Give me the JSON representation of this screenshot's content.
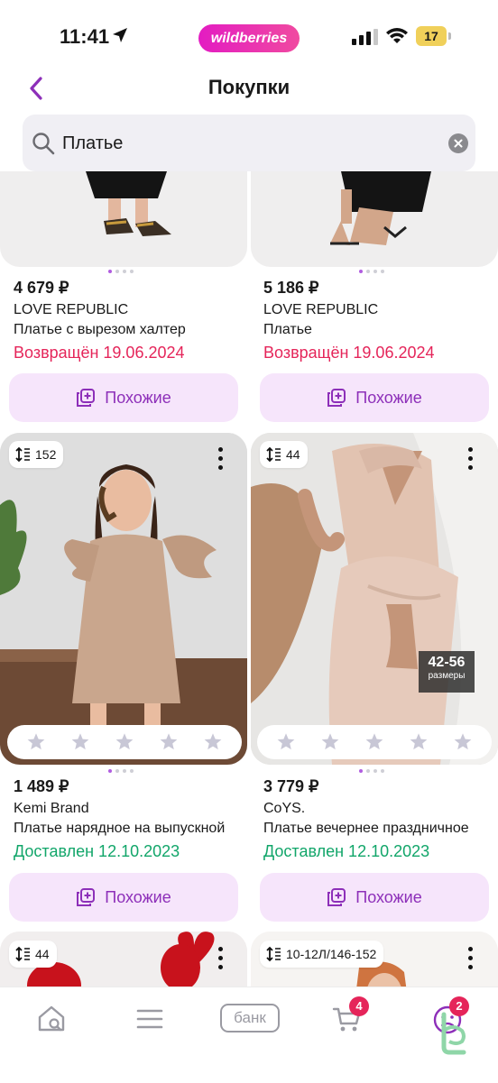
{
  "status_bar": {
    "time": "11:41",
    "brand_pill": "wildberries",
    "battery": "17"
  },
  "header": {
    "title": "Покупки"
  },
  "search": {
    "value": "Платье"
  },
  "products": [
    {
      "price": "4 679 ₽",
      "brand": "LOVE REPUBLIC",
      "name": "Платье с вырезом халтер",
      "status": "Возвращён 19.06.2024",
      "similar_label": "Похожие"
    },
    {
      "price": "5 186 ₽",
      "brand": "LOVE REPUBLIC",
      "name": "Платье",
      "status": "Возвращён 19.06.2024",
      "similar_label": "Похожие"
    },
    {
      "size_count": "152",
      "price": "1 489 ₽",
      "brand": "Kemi Brand",
      "name": "Платье нарядное на выпускной",
      "status": "Доставлен 12.10.2023",
      "similar_label": "Похожие"
    },
    {
      "size_count": "44",
      "sizes_tag_value": "42-56",
      "sizes_tag_label": "размеры",
      "price": "3 779 ₽",
      "brand": "CoYS.",
      "name": "Платье вечернее праздничное",
      "status": "Доставлен 12.10.2023",
      "similar_label": "Похожие"
    },
    {
      "size_count": "44"
    },
    {
      "size_count": "10-12Л/146-152"
    }
  ],
  "bottom_nav": {
    "bank_label": "банк",
    "cart_badge": "4",
    "profile_badge": "2"
  },
  "colors": {
    "accent": "#8d2fb9",
    "returned": "#e5255a",
    "delivered": "#12a66a",
    "similar_bg": "#f6e5fb"
  }
}
